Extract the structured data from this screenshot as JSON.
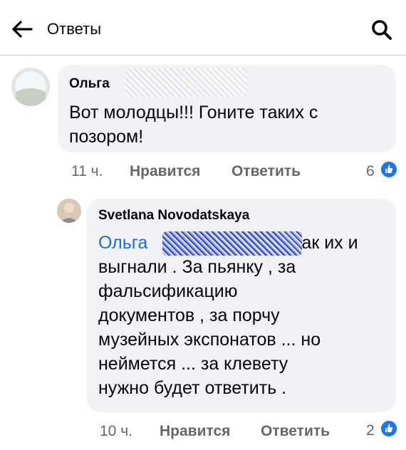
{
  "header": {
    "title": "Ответы",
    "back_icon": "arrow-left-icon",
    "search_icon": "search-icon"
  },
  "comments": [
    {
      "author": "Ольга",
      "text": "Вот молодцы!!! Гоните таких с позором!",
      "time": "11 ч.",
      "like_label": "Нравится",
      "reply_label": "Ответить",
      "reactions": "6",
      "reaction_icon": "like-icon"
    },
    {
      "author": "Svetlana Novodatskaya",
      "mention": "Ольга",
      "text_after_mention": "так их и",
      "text_lines": [
        "выгнали . За пьянку , за",
        "фальсификацию",
        "документов , за порчу",
        "музейных экспонатов ... но",
        "неймется ... за клевету",
        "нужно будет ответить ."
      ],
      "time": "10 ч.",
      "like_label": "Нравится",
      "reply_label": "Ответить",
      "reactions": "2",
      "reaction_icon": "like-icon"
    }
  ],
  "colors": {
    "mention": "#1a6ed8",
    "bubble": "#f0f2f5",
    "meta": "#65676b",
    "like_badge": "#1877f2"
  }
}
